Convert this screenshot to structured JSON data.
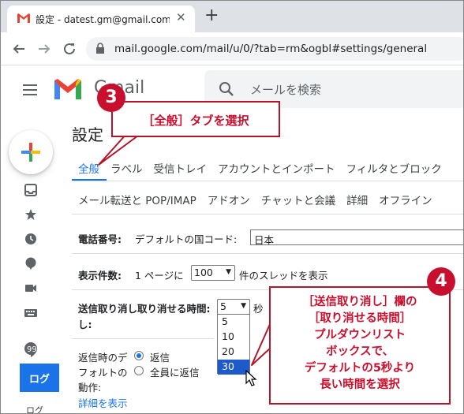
{
  "browser": {
    "tab_title": "設定 - datest.gm@gmail.com - G",
    "tab_close": "✕",
    "new_tab": "+",
    "url": "mail.google.com/mail/u/0/?tab=rm&ogbl#settings/general"
  },
  "gmail": {
    "logo_text": "Gmail",
    "search_placeholder": "メールを検索"
  },
  "rail": {
    "button_label": "ログ",
    "bottom_label": "ログ"
  },
  "settings": {
    "title": "設定",
    "tabs_row1": [
      "全般",
      "ラベル",
      "受信トレイ",
      "アカウントとインポート",
      "フィルタとブロック"
    ],
    "tabs_row2": [
      "メール転送と POP/IMAP",
      "アドオン",
      "チャットと会議",
      "詳細",
      "オフライン"
    ],
    "phone_label": "電話番号:",
    "phone_text": "デフォルトの国コード:",
    "phone_value": "日本",
    "display_label": "表示件数:",
    "display_prefix": "1 ページに",
    "display_value": "100",
    "display_suffix": "件のスレッドを表示",
    "undo_label_1": "送信取り消し取り消せる時間:",
    "undo_label_2": "し:",
    "undo_value": "5",
    "undo_unit": "秒",
    "undo_options": [
      "5",
      "10",
      "20",
      "30"
    ],
    "undo_highlighted": "30",
    "reply_label_1": "返信時のデ",
    "reply_label_2": "フォルトの",
    "reply_label_3": "動作:",
    "reply_opt1": "返信",
    "reply_opt2": "全員に返信",
    "details_link": "詳細を表示"
  },
  "annotations": {
    "callout3_number": "3",
    "callout3_text": "［全般］タブを選択",
    "callout4_number": "4",
    "callout4_lines": [
      "［送信取り消し］欄の",
      "［取り消せる時間］",
      "プルダウンリスト",
      "ボックスで、",
      "デフォルトの5秒より",
      "長い時間を選択"
    ]
  },
  "colors": {
    "accent": "#1a73e8",
    "callout_red": "#c8102e",
    "dropdown_highlight": "#1e5ac9"
  }
}
